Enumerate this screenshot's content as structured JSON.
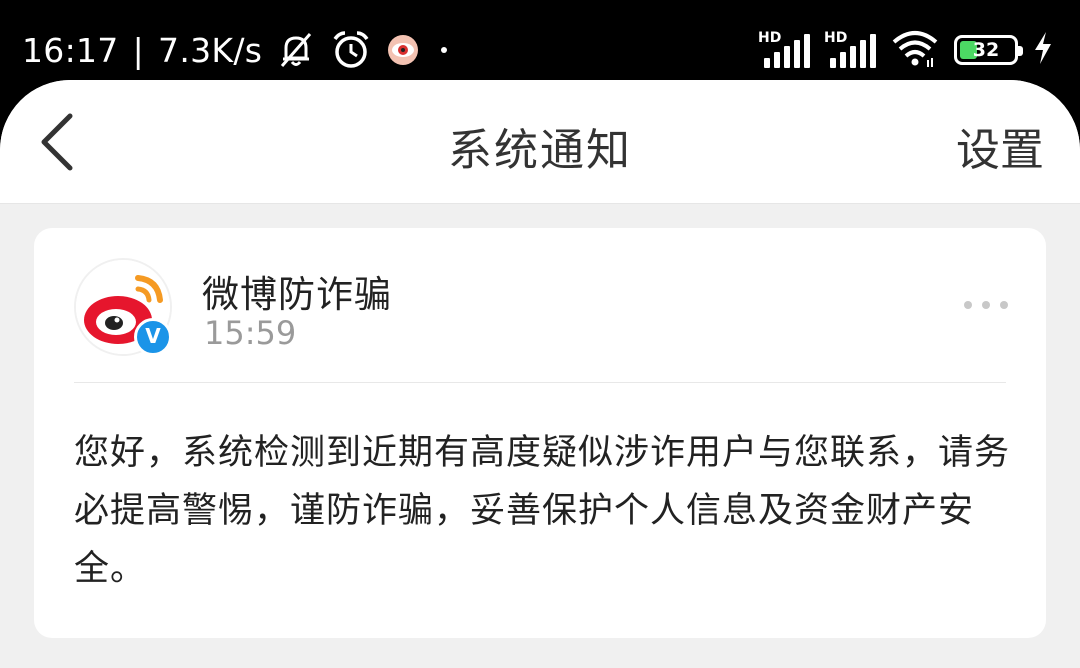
{
  "status_bar": {
    "time": "16:17",
    "speed": "7.3K/s",
    "sim1_label": "HD",
    "sim2_label": "HD",
    "battery_level": "32",
    "battery_fraction": 0.32,
    "icons": [
      "mute-bell-icon",
      "alarm-icon",
      "eye-app-icon",
      "dot-icon",
      "signal-icon",
      "wifi-icon",
      "battery-icon",
      "charging-icon"
    ]
  },
  "navbar": {
    "title": "系统通知",
    "settings_label": "设置",
    "back_icon": "chevron-left-icon"
  },
  "notification": {
    "sender": "微博防诈骗",
    "time": "15:59",
    "verified_badge": "V",
    "message": "您好，系统检测到近期有高度疑似涉诈用户与您联系，请务必提高警惕，谨防诈骗，妥善保护个人信息及资金财产安全。"
  },
  "colors": {
    "accent_verified": "#1b94e8",
    "weibo_red": "#e6162d",
    "weibo_orange": "#f59a23",
    "battery_green": "#4cd964"
  }
}
